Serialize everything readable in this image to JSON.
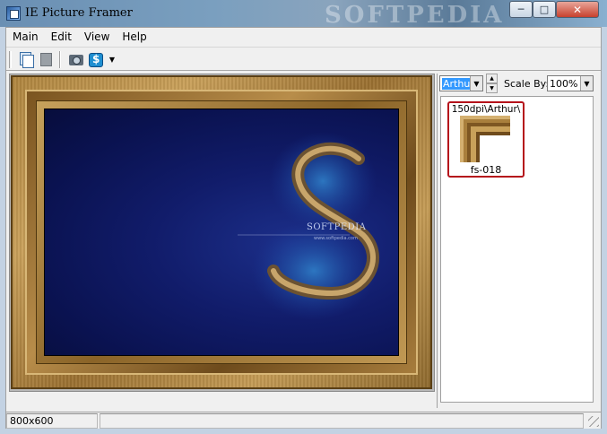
{
  "window": {
    "title": "IE Picture Framer",
    "watermark": "SOFTPEDIA",
    "controls": {
      "minimize": "─",
      "maximize": "□",
      "close": "✕"
    }
  },
  "menu": [
    {
      "label": "Main"
    },
    {
      "label": "Edit"
    },
    {
      "label": "View"
    },
    {
      "label": "Help"
    }
  ],
  "toolbar": {
    "buttons": [
      {
        "icon": "copy-icon"
      },
      {
        "icon": "paste-icon"
      },
      {
        "icon": "camera-icon"
      },
      {
        "icon": "scan-icon"
      }
    ],
    "dropdown_glyph": "▼"
  },
  "canvas": {
    "picture_logo": "SOFTPEDIA",
    "picture_url": "www.softpedia.com"
  },
  "frame_picker": {
    "selected_frame": "Arthur",
    "spin_up": "▲",
    "spin_down": "▼",
    "scale_label": "Scale By:",
    "scale_value": "100%",
    "combo_arrow": "▼"
  },
  "thumbnails": [
    {
      "path": "150dpi\\Arthur\\",
      "caption": "fs-018",
      "selected": true
    }
  ],
  "status": {
    "dimensions": "800x600",
    "message": ""
  },
  "colors": {
    "frame_gold": "#b08640",
    "picture_navy": "#0a1250",
    "selection_red": "#b5121b",
    "highlight_blue": "#3399ff"
  }
}
